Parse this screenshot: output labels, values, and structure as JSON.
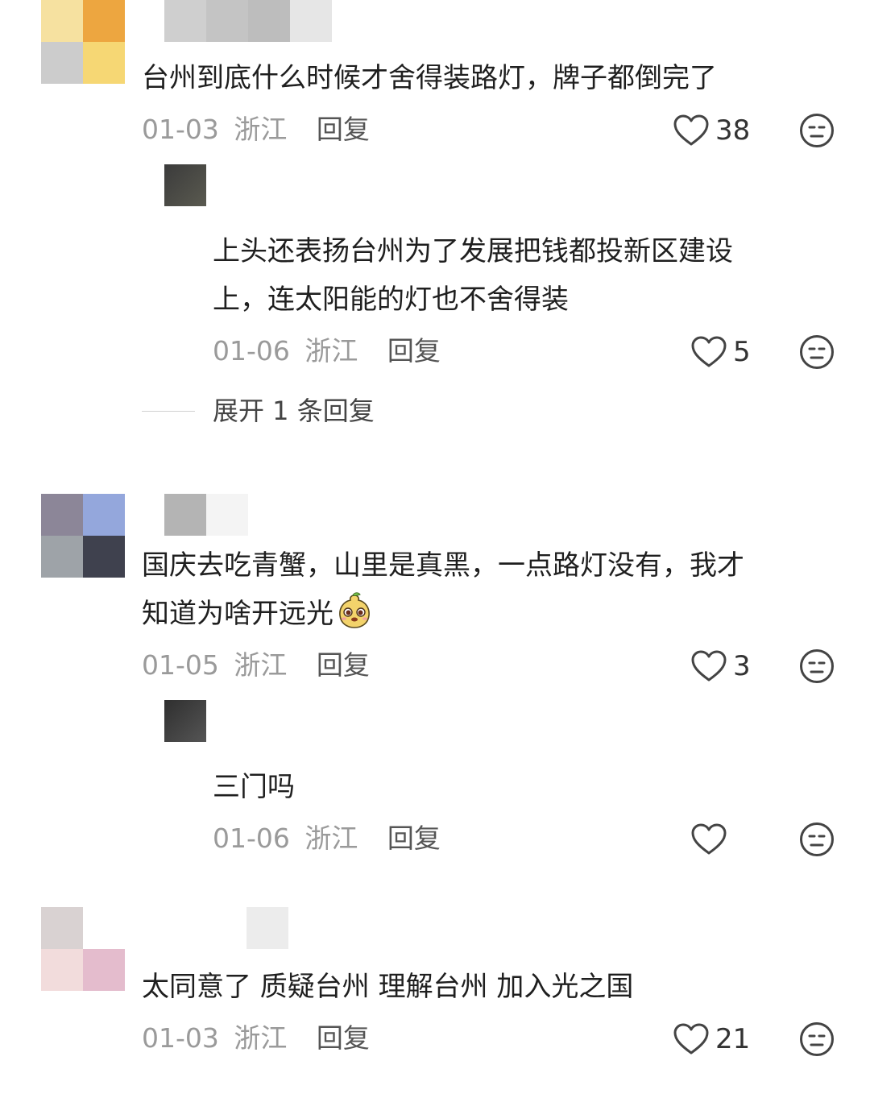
{
  "comments": [
    {
      "text_lines": [
        "台州到底什么时候才舍得装路灯，牌子都倒完了"
      ],
      "date": "01-03",
      "location": "浙江",
      "reply_label": "回复",
      "likes": "38",
      "avatar_colors": [
        "#f6e1a0",
        "#eda640",
        "#cccccc",
        "#f6d774"
      ],
      "reply": {
        "text_lines": [
          "上头还表扬台州为了发展把钱都投新区建设",
          "上，连太阳能的灯也不舍得装"
        ],
        "date": "01-06",
        "location": "浙江",
        "reply_label": "回复",
        "likes": "5"
      },
      "expand_label": "展开 1 条回复"
    },
    {
      "text_lines": [
        "国庆去吃青蟹，山里是真黑，一点路灯没有，我才",
        "知道为啥开远光"
      ],
      "date": "01-05",
      "location": "浙江",
      "reply_label": "回复",
      "likes": "3",
      "avatar_colors": [
        "#8c8698",
        "#94a7dc",
        "#9ea3a8",
        "#3f414e"
      ],
      "reply": {
        "text_lines": [
          "三门吗"
        ],
        "date": "01-06",
        "location": "浙江",
        "reply_label": "回复",
        "likes": ""
      }
    },
    {
      "text_lines": [
        "太同意了 质疑台州 理解台州 加入光之国"
      ],
      "date": "01-03",
      "location": "浙江",
      "reply_label": "回复",
      "likes": "21",
      "avatar_colors": [
        "#d9d2d2",
        "#ffffff",
        "#f2dcdc",
        "#e4bccd"
      ]
    }
  ],
  "icons": {
    "like": "heart-outline-icon",
    "dislike": "neutral-face-icon",
    "emoji": "gourd-doll-emoji-icon"
  }
}
